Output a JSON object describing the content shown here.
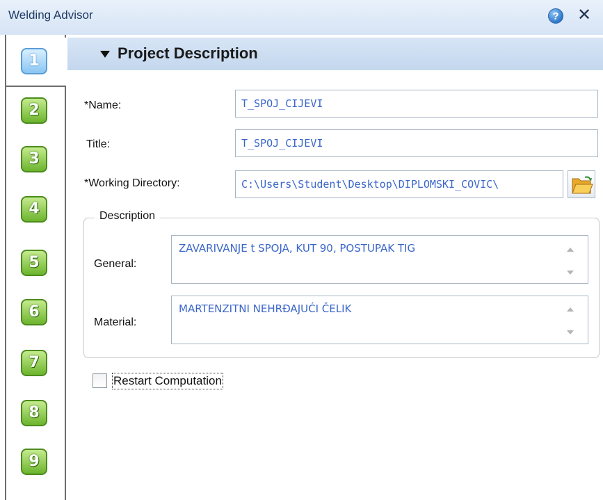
{
  "window": {
    "title": "Welding Advisor"
  },
  "steps": [
    {
      "label": "1",
      "active": true
    },
    {
      "label": "2"
    },
    {
      "label": "3"
    },
    {
      "label": "4"
    },
    {
      "label": "5"
    },
    {
      "label": "6"
    },
    {
      "label": "7"
    },
    {
      "label": "8"
    },
    {
      "label": "9"
    }
  ],
  "section": {
    "title": "Project Description"
  },
  "form": {
    "name_label": "*Name:",
    "name_value": "T_SPOJ_CIJEVI",
    "title_label": "Title:",
    "title_value": "T_SPOJ_CIJEVI",
    "workdir_label": "*Working Directory:",
    "workdir_value": "C:\\Users\\Student\\Desktop\\DIPLOMSKI_COVIC\\"
  },
  "description": {
    "legend": "Description",
    "general_label": "General:",
    "general_value": "ZAVARIVANJE t SPOJA, KUT 90, POSTUPAK TIG",
    "material_label": "Material:",
    "material_value": "MARTENZITNI NEHRĐAJUĆI ČELIK"
  },
  "restart": {
    "label": "Restart Computation",
    "checked": false
  },
  "colors": {
    "step_green": "#6cb42d",
    "step_blue": "#8ac6f2",
    "field_text": "#3a66c9",
    "header_bg": "#c4d7ee"
  },
  "icons": [
    "help-icon",
    "close-icon",
    "folder-open-icon",
    "expand-arrow-icon",
    "scroll-up-icon",
    "scroll-down-icon"
  ]
}
